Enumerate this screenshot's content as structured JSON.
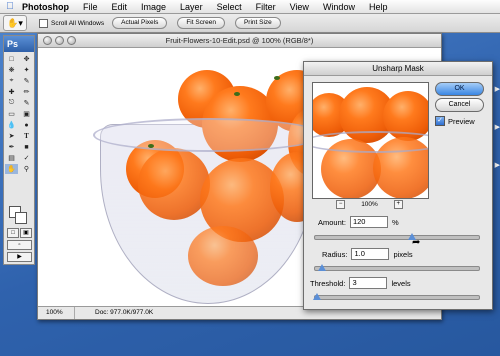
{
  "menubar": {
    "app": "Photoshop",
    "items": [
      "File",
      "Edit",
      "Image",
      "Layer",
      "Select",
      "Filter",
      "View",
      "Window",
      "Help"
    ]
  },
  "options": {
    "scroll_all": "Scroll All Windows",
    "buttons": [
      "Actual Pixels",
      "Fit Screen",
      "Print Size"
    ]
  },
  "toolbox": {
    "logo": "Ps"
  },
  "document": {
    "title": "Fruit-Flowers-10-Edit.psd @ 100% (RGB/8*)",
    "zoom": "100%",
    "doc_info": "Doc: 977.0K/977.0K"
  },
  "dialog": {
    "title": "Unsharp Mask",
    "ok": "OK",
    "cancel": "Cancel",
    "preview": "Preview",
    "preview_zoom": "100%",
    "amount_label": "Amount:",
    "amount_value": "120",
    "amount_unit": "%",
    "radius_label": "Radius:",
    "radius_value": "1.0",
    "radius_unit": "pixels",
    "threshold_label": "Threshold:",
    "threshold_value": "3",
    "threshold_unit": "levels"
  },
  "colors": {
    "accent": "#3a86e3",
    "orange": "#ee5d08"
  }
}
